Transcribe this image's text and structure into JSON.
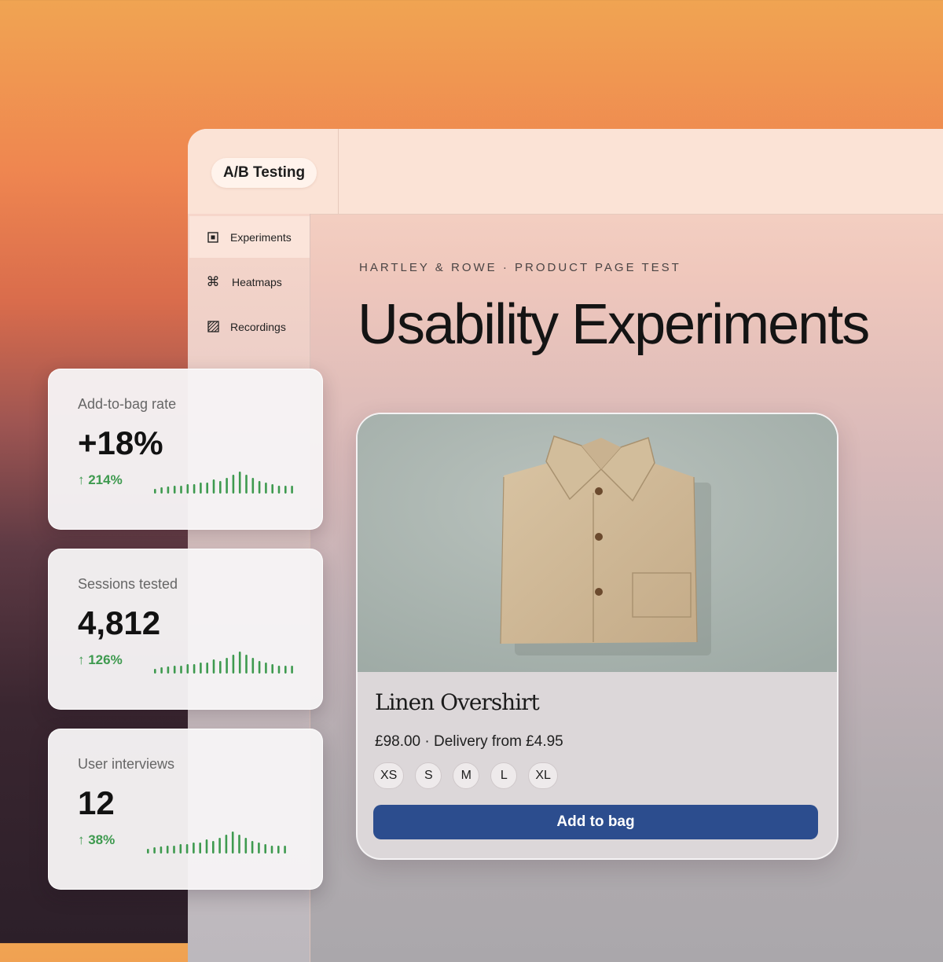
{
  "app": {
    "title": "A/B Testing"
  },
  "sidebar": {
    "items": [
      {
        "label": "Experiments",
        "icon": "square-dot-icon",
        "active": true
      },
      {
        "label": "Heatmaps",
        "icon": "command-icon",
        "active": false
      },
      {
        "label": "Recordings",
        "icon": "hatched-square-icon",
        "active": false
      }
    ]
  },
  "main": {
    "eyebrow": "HARTLEY & ROWE · PRODUCT PAGE TEST",
    "title": "Usability Experiments"
  },
  "product": {
    "name": "Linen Overshirt",
    "price_line": "£98.00 · Delivery from £4.95",
    "sizes": [
      "XS",
      "S",
      "M",
      "L",
      "XL"
    ],
    "add_button": "Add to bag"
  },
  "stats": [
    {
      "label": "Add-to-bag rate",
      "value": "+18%",
      "delta": "↑ 214%"
    },
    {
      "label": "Sessions tested",
      "value": "4,812",
      "delta": "↑ 126%"
    },
    {
      "label": "User interviews",
      "value": "12",
      "delta": "↑ 38%"
    }
  ],
  "colors": {
    "accent_button": "#2c4d8e",
    "positive": "#3e9a4f",
    "active_nav": "#fbe4da"
  }
}
